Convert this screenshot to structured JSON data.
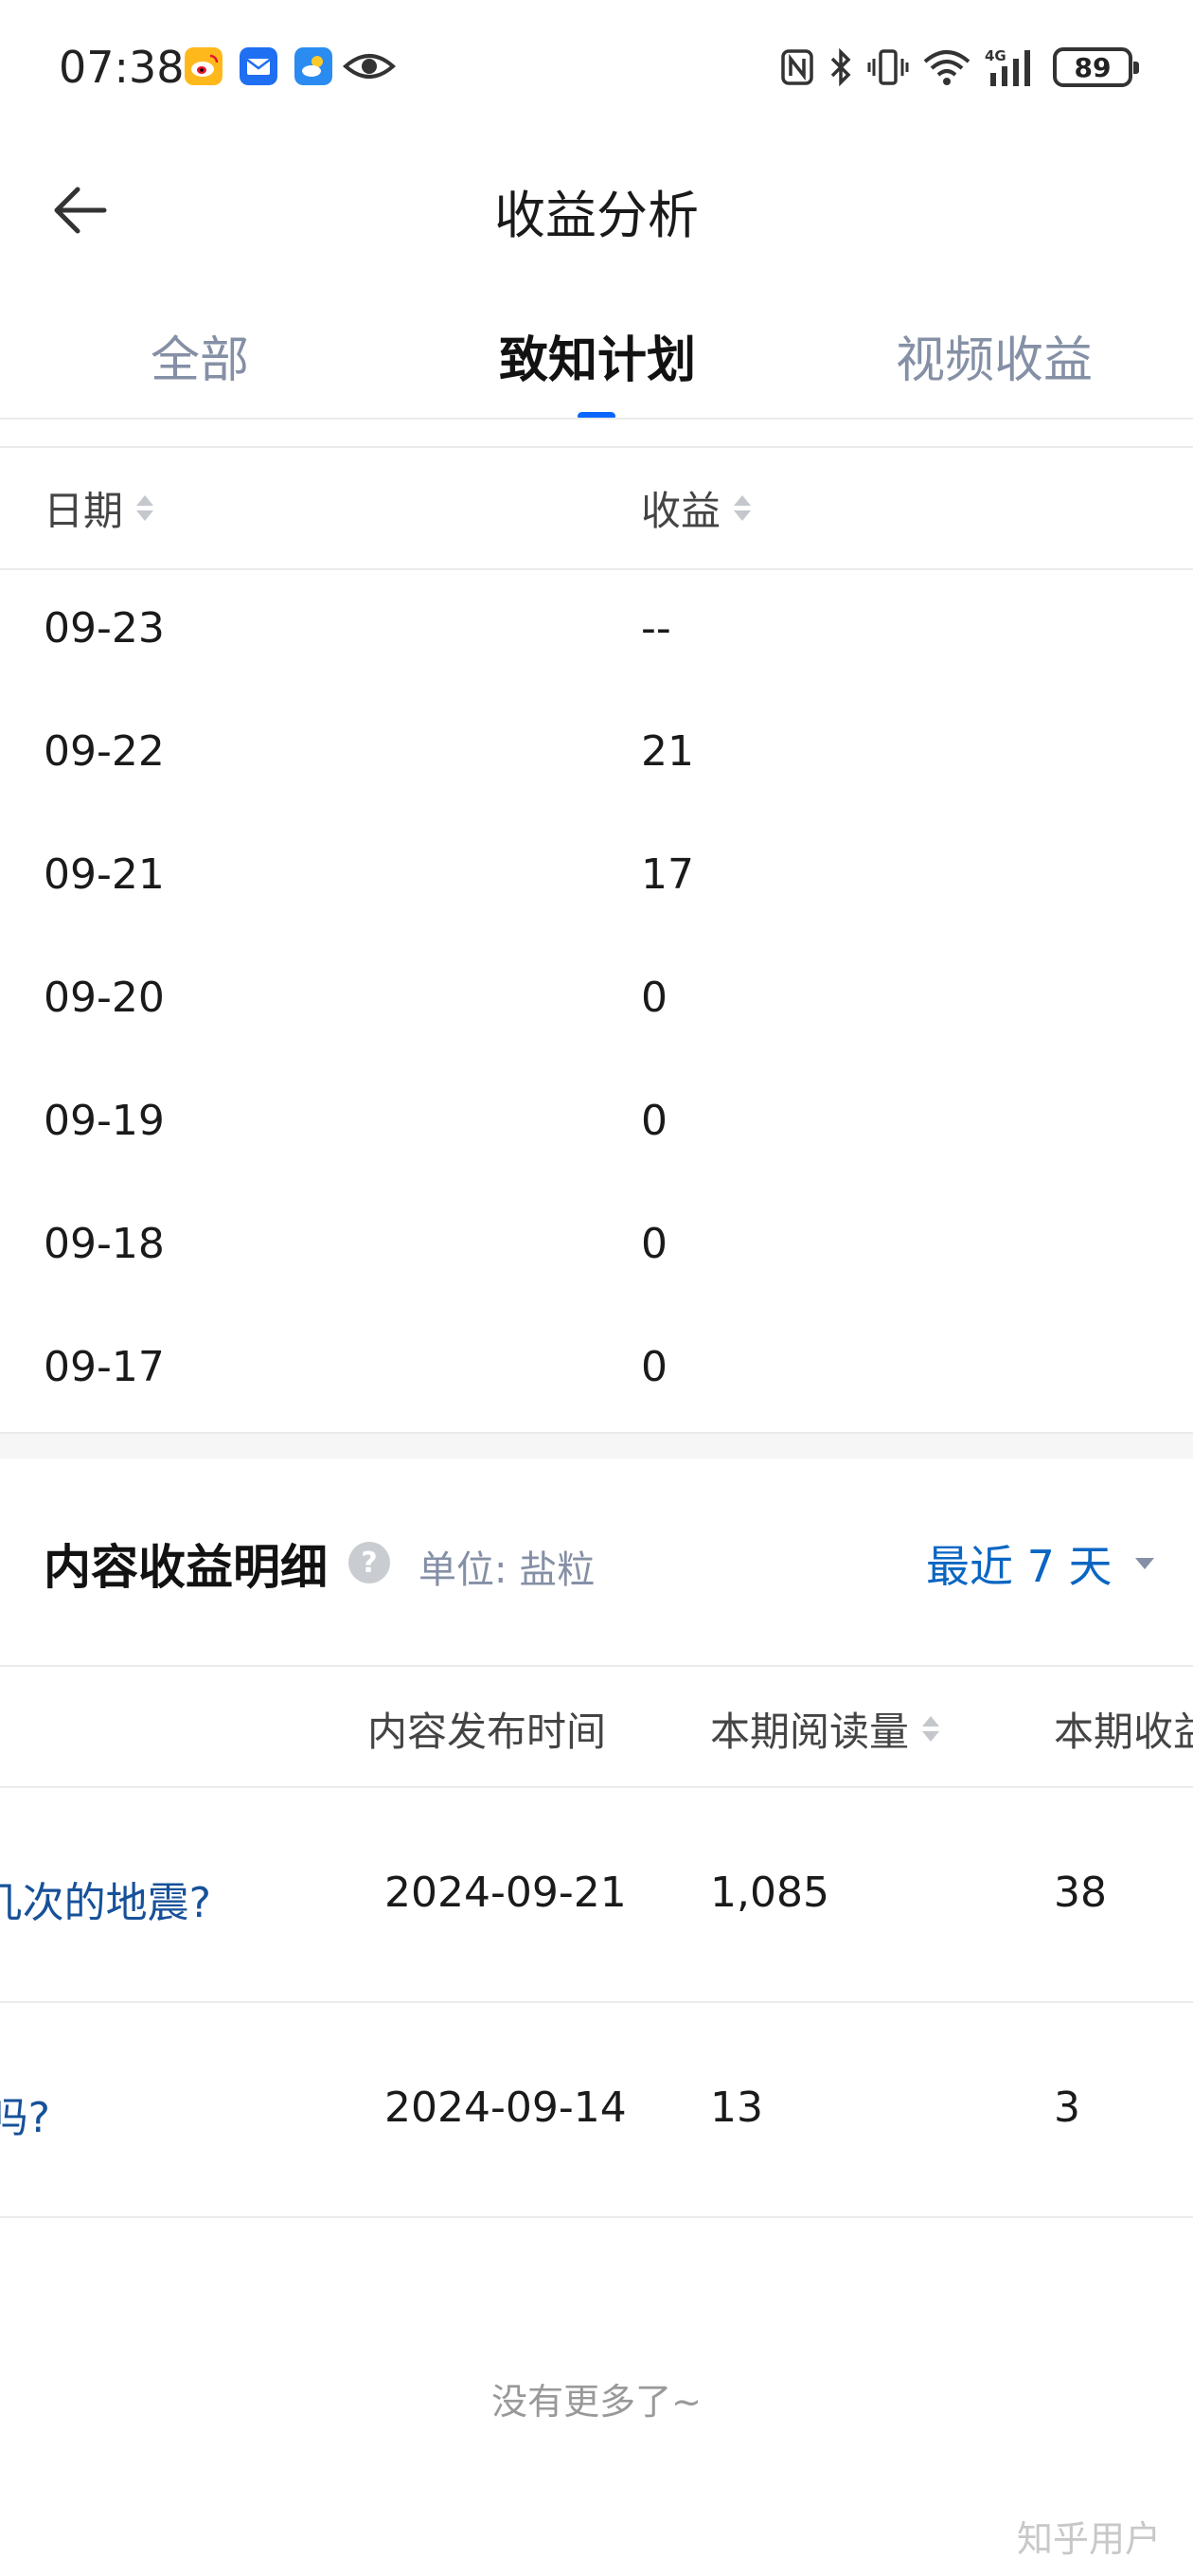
{
  "status_bar": {
    "time": "07:38",
    "battery": "89",
    "icons": [
      "weibo-icon",
      "mail-icon",
      "weather-icon",
      "eye-icon",
      "nfc-icon",
      "bluetooth-icon",
      "vibrate-icon",
      "wifi-icon",
      "signal-4g-icon",
      "battery-icon"
    ]
  },
  "header": {
    "title": "收益分析",
    "back_icon": "arrow-left-icon"
  },
  "tabs": [
    {
      "label": "全部",
      "active": false
    },
    {
      "label": "致知计划",
      "active": true
    },
    {
      "label": "视频收益",
      "active": false
    }
  ],
  "daily_table": {
    "columns": [
      "日期",
      "收益"
    ],
    "rows": [
      {
        "date": "09-23",
        "value": "--"
      },
      {
        "date": "09-22",
        "value": "21"
      },
      {
        "date": "09-21",
        "value": "17"
      },
      {
        "date": "09-20",
        "value": "0"
      },
      {
        "date": "09-19",
        "value": "0"
      },
      {
        "date": "09-18",
        "value": "0"
      },
      {
        "date": "09-17",
        "value": "0"
      }
    ]
  },
  "content_section": {
    "title": "内容收益明细",
    "help_icon": "question-circle-icon",
    "unit": "单位: 盐粒",
    "range": "最近 7 天",
    "columns": [
      "内容发布时间",
      "本期阅读量",
      "本期收益"
    ],
    "rows": [
      {
        "title_fragment": "几次的地震?",
        "publish_time": "2024-09-21",
        "reads": "1,085",
        "earnings": "38"
      },
      {
        "title_fragment": "吗?",
        "publish_time": "2024-09-14",
        "reads": "13",
        "earnings": "3"
      }
    ]
  },
  "footer": {
    "no_more": "没有更多了~",
    "watermark": "知乎用户"
  },
  "colors": {
    "accent": "#0a66ff",
    "link": "#175199",
    "muted": "#8590a6"
  }
}
